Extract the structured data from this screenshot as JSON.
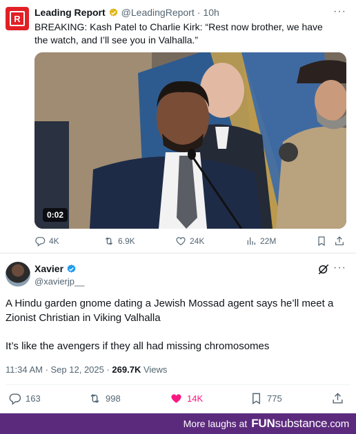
{
  "quoted_tweet": {
    "author_name": "Leading Report",
    "author_handle": "@LeadingReport",
    "separator": "·",
    "time": "10h",
    "avatar_text": "R",
    "text": "BREAKING: Kash Patel to Charlie Kirk: “Rest now brother, we have the watch, and I’ll see you in Valhalla.”",
    "video_duration": "0:02",
    "actions": {
      "replies": "4K",
      "reposts": "6.9K",
      "likes": "24K",
      "views": "22M"
    }
  },
  "tweet": {
    "author_name": "Xavier",
    "author_handle": "@xavierjp__",
    "text_1": "A Hindu garden gnome dating a Jewish Mossad agent says he’ll meet a Zionist Christian in Viking Valhalla",
    "text_2": "It’s like the avengers if they all had missing chromosomes",
    "timestamp": "11:34 AM · Sep 12, 2025 · ",
    "views_count": "269.7K",
    "views_label": " Views",
    "actions": {
      "replies": "163",
      "reposts": "998",
      "likes": "14K",
      "bookmarks": "775"
    }
  },
  "footer": {
    "text": "More laughs at",
    "brand_fun": "FUN",
    "brand_substance": "substance",
    "brand_com": ".com"
  },
  "colors": {
    "verified_gold": "#e2b719",
    "verified_blue": "#1d9bf0",
    "like_pink": "#f91880",
    "footer_purple": "#5c2a7d",
    "secondary_text": "#536471"
  },
  "icons": [
    "more-icon",
    "reply-icon",
    "repost-icon",
    "like-icon",
    "views-icon",
    "bookmark-icon",
    "share-icon",
    "grok-icon",
    "verified-badge-icon"
  ]
}
